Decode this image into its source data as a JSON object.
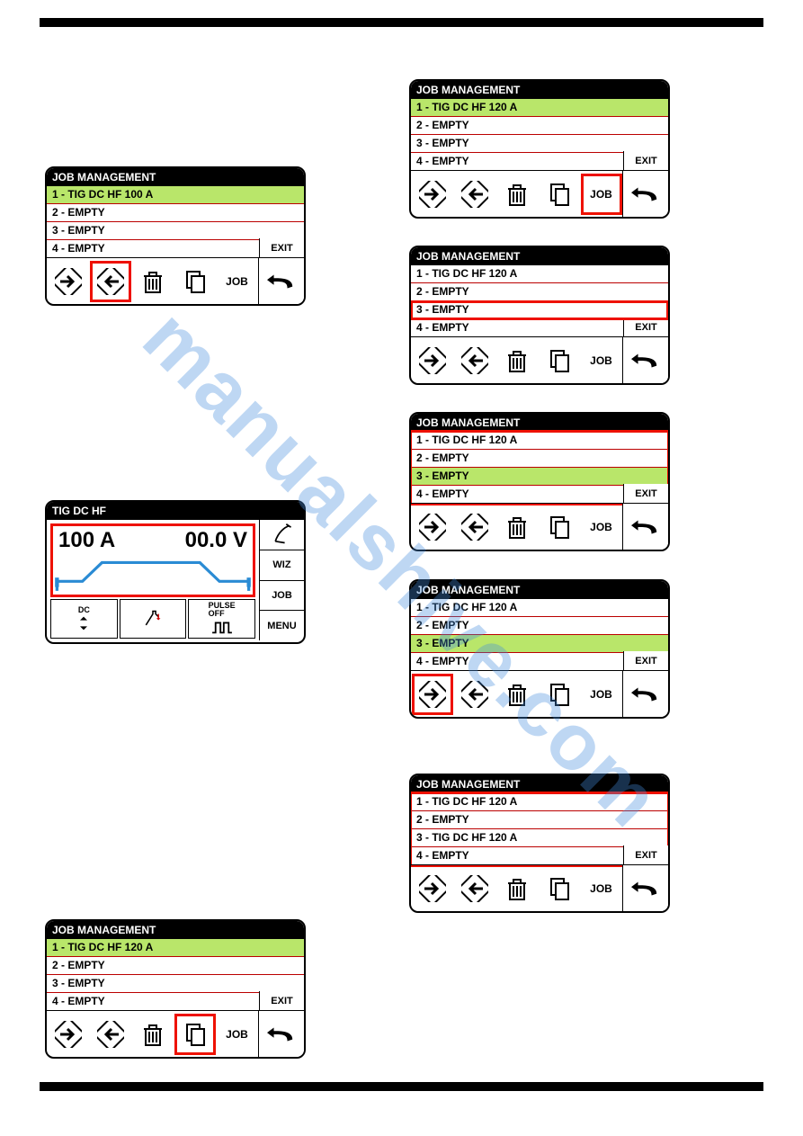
{
  "watermark": "manualshive.com",
  "panels": {
    "left1": {
      "title": "JOB MANAGEMENT",
      "rows": [
        "1 - TIG DC HF 100 A",
        "2 - EMPTY",
        "3 - EMPTY",
        "4 - EMPTY"
      ],
      "selected_index": 0,
      "red_row_index": null,
      "red_list": false,
      "icons": [
        "arrow-in",
        "arrow-out",
        "trash",
        "copy",
        "job"
      ],
      "red_icon_index": 1,
      "exit": "EXIT",
      "job_label": "JOB"
    },
    "left2": {
      "title": "JOB MANAGEMENT",
      "rows": [
        "1 - TIG DC HF 120 A",
        "2 - EMPTY",
        "3 - EMPTY",
        "4 - EMPTY"
      ],
      "selected_index": 0,
      "red_row_index": null,
      "red_list": false,
      "icons": [
        "arrow-in",
        "arrow-out",
        "trash",
        "copy",
        "job"
      ],
      "red_icon_index": 3,
      "exit": "EXIT",
      "job_label": "JOB"
    },
    "r1": {
      "title": "JOB MANAGEMENT",
      "rows": [
        "1 - TIG DC HF 120 A",
        "2 - EMPTY",
        "3 - EMPTY",
        "4 - EMPTY"
      ],
      "selected_index": 0,
      "red_row_index": null,
      "red_list": false,
      "icons": [
        "arrow-in",
        "arrow-out",
        "trash",
        "copy",
        "job"
      ],
      "red_icon_index": 4,
      "exit": "EXIT",
      "job_label": "JOB"
    },
    "r2": {
      "title": "JOB MANAGEMENT",
      "rows": [
        "1 - TIG DC HF 120 A",
        "2 - EMPTY",
        "3 - EMPTY",
        "4 - EMPTY"
      ],
      "selected_index": null,
      "red_row_index": 2,
      "red_list": false,
      "icons": [
        "arrow-in",
        "arrow-out",
        "trash",
        "copy",
        "job"
      ],
      "red_icon_index": null,
      "exit": "EXIT",
      "job_label": "JOB"
    },
    "r3": {
      "title": "JOB MANAGEMENT",
      "rows": [
        "1 - TIG DC HF 120 A",
        "2 - EMPTY",
        "3 - EMPTY",
        "4 - EMPTY"
      ],
      "selected_index": 2,
      "red_row_index": null,
      "red_list": true,
      "icons": [
        "arrow-in",
        "arrow-out",
        "trash",
        "copy",
        "job"
      ],
      "red_icon_index": null,
      "exit": "EXIT",
      "job_label": "JOB"
    },
    "r4": {
      "title": "JOB MANAGEMENT",
      "rows": [
        "1 - TIG DC HF 120 A",
        "2 - EMPTY",
        "3 - EMPTY",
        "4 - EMPTY"
      ],
      "selected_index": 2,
      "red_row_index": null,
      "red_list": false,
      "icons": [
        "arrow-in",
        "arrow-out",
        "trash",
        "copy",
        "job"
      ],
      "red_icon_index": 0,
      "exit": "EXIT",
      "job_label": "JOB"
    },
    "r5": {
      "title": "JOB MANAGEMENT",
      "rows": [
        "1 - TIG DC HF 120 A",
        "2 - EMPTY",
        "3 - TIG DC HF 120 A",
        "4 - EMPTY"
      ],
      "selected_index": null,
      "red_row_index": null,
      "red_list": true,
      "icons": [
        "arrow-in",
        "arrow-out",
        "trash",
        "copy",
        "job"
      ],
      "red_icon_index": null,
      "exit": "EXIT",
      "job_label": "JOB"
    }
  },
  "weld": {
    "title": "TIG DC HF",
    "amps": "100 A",
    "volts": "00.0 V",
    "right_buttons": [
      "torch-icon",
      "WIZ",
      "JOB",
      "MENU"
    ],
    "modes": {
      "dc": "DC",
      "pulse": "PULSE\nOFF"
    }
  }
}
